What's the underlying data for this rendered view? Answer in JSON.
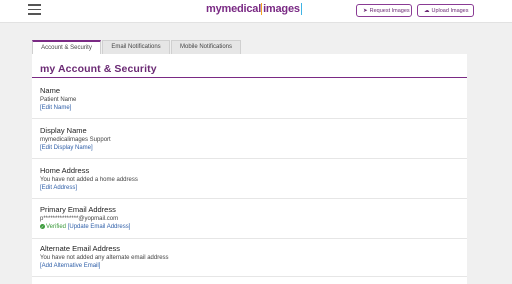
{
  "header": {
    "logo": {
      "my": "my",
      "medical": "medical",
      "images": "images"
    },
    "request_button": {
      "icon": "send-icon",
      "label": "Request Images"
    },
    "upload_button": {
      "icon": "cloud-upload-icon",
      "label": "Upload Images"
    }
  },
  "tabs": [
    {
      "label": "Account & Security",
      "active": true
    },
    {
      "label": "Email Notifications",
      "active": false
    },
    {
      "label": "Mobile Notifications",
      "active": false
    }
  ],
  "panel": {
    "title": "my Account & Security",
    "sections": [
      {
        "label": "Name",
        "value": "Patient Name",
        "link": "[Edit Name]"
      },
      {
        "label": "Display Name",
        "value": "mymedicalimages Support",
        "link": "[Edit Display Name]"
      },
      {
        "label": "Home Address",
        "value": "You have not added a home address",
        "link": "[Edit Address]"
      },
      {
        "label": "Primary Email Address",
        "value": "p***************@yopmail.com",
        "verified": "Verified",
        "link": "[Update Email Address]"
      },
      {
        "label": "Alternate Email Address",
        "value": "You have not added any alternate email address",
        "link": "[Add Alternative Email]"
      }
    ]
  },
  "colors": {
    "brand": "#7a2a84",
    "link": "#2f5fa8",
    "verified": "#3a9a3a"
  }
}
